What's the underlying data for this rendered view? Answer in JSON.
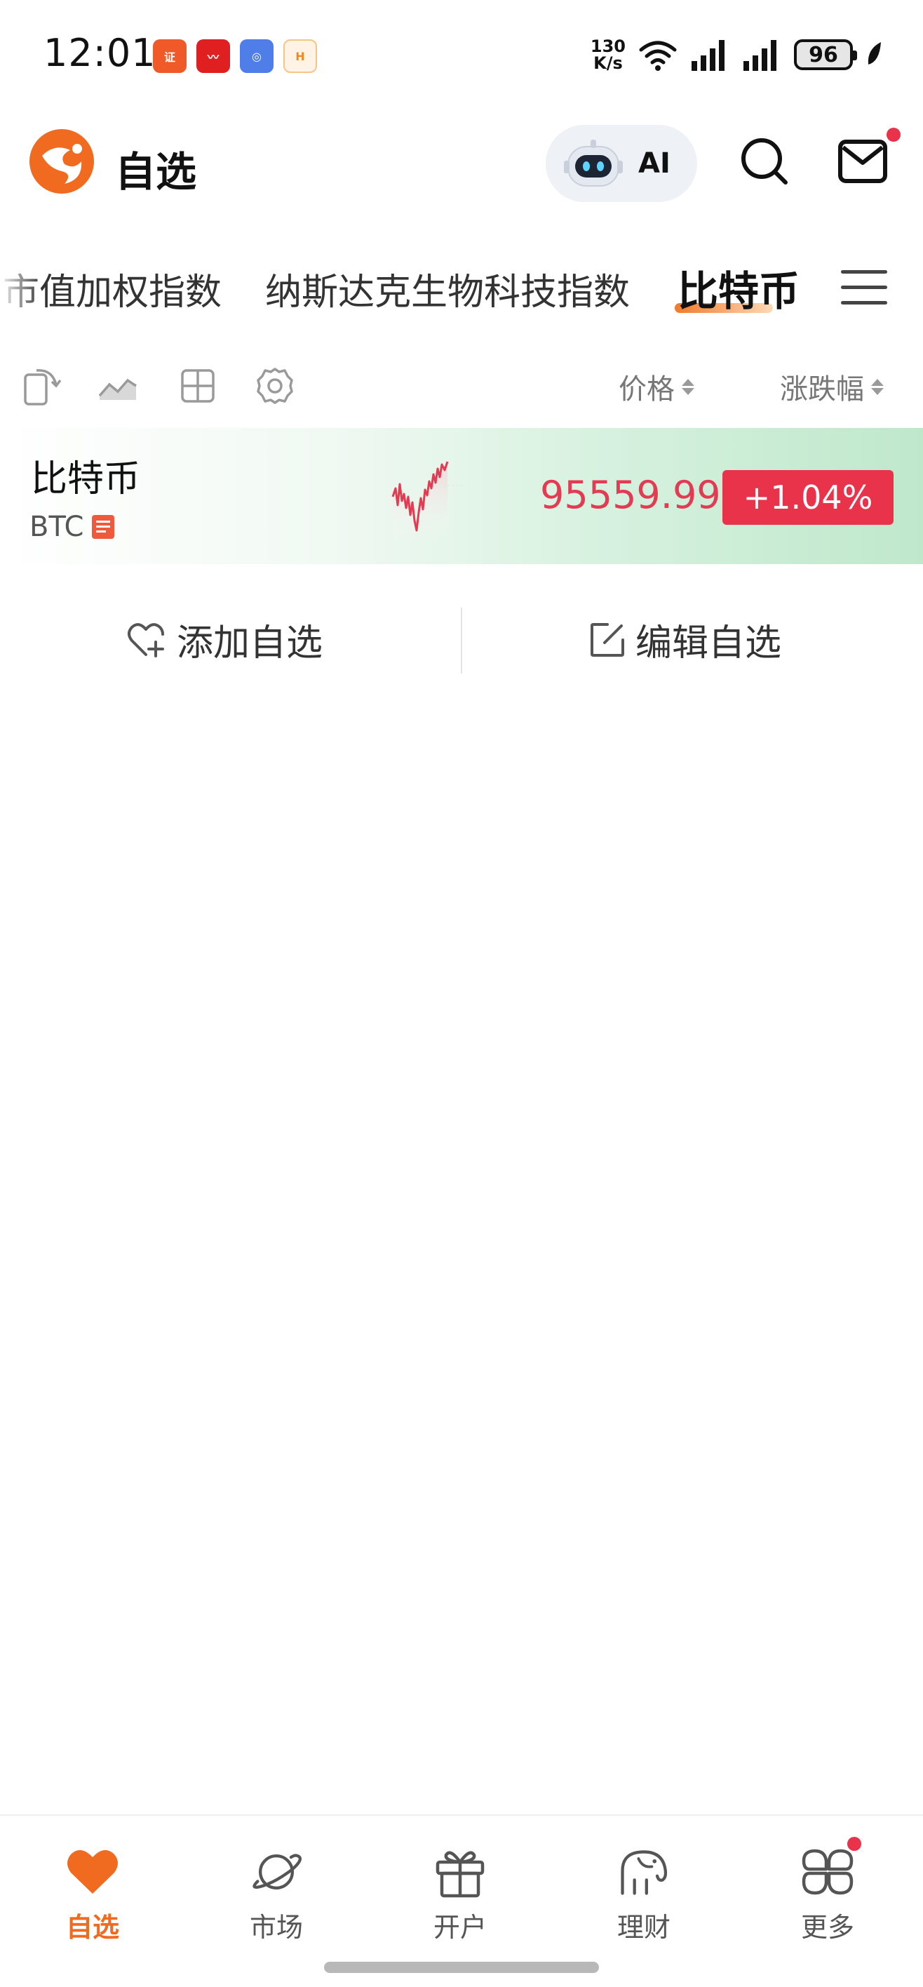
{
  "status_bar": {
    "time": "12:01",
    "net_speed_value": "130",
    "net_speed_unit": "K/s",
    "battery": "96"
  },
  "header": {
    "title": "自选",
    "ai_label": "AI"
  },
  "tabs": [
    {
      "label": "市值加权指数",
      "active": false
    },
    {
      "label": "纳斯达克生物科技指数",
      "active": false
    },
    {
      "label": "比特币",
      "active": true
    }
  ],
  "columns": {
    "price": "价格",
    "change": "涨跌幅"
  },
  "watchlist": [
    {
      "name": "比特币",
      "code": "BTC",
      "price": "95559.99",
      "change": "+1.04%"
    }
  ],
  "actions": {
    "add": "添加自选",
    "edit": "编辑自选"
  },
  "bottom_nav": [
    {
      "label": "自选",
      "icon": "heart-icon",
      "active": true
    },
    {
      "label": "市场",
      "icon": "planet-icon",
      "active": false
    },
    {
      "label": "开户",
      "icon": "gift-icon",
      "active": false
    },
    {
      "label": "理财",
      "icon": "elephant-icon",
      "active": false
    },
    {
      "label": "更多",
      "icon": "grid-icon",
      "active": false
    }
  ],
  "colors": {
    "brand_orange": "#f06a1f",
    "up_red": "#e8334a",
    "row_green": "#bfe8cb"
  }
}
